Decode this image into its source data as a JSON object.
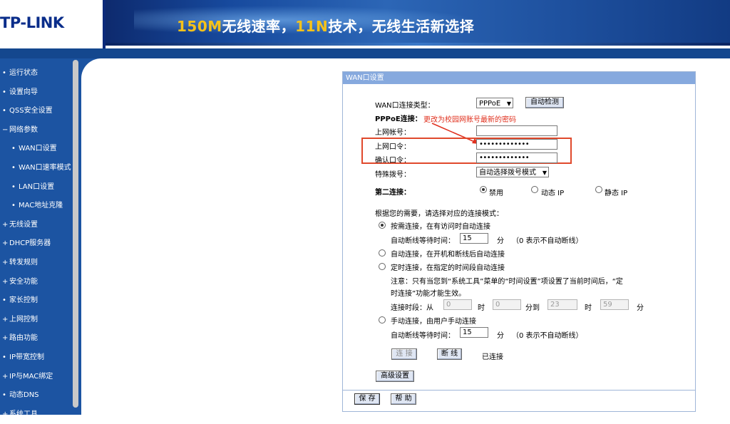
{
  "header": {
    "logo_text": "TP-LINK",
    "slogan_part1": "150M",
    "slogan_part2": "无线速率，",
    "slogan_part3": "11N",
    "slogan_part4": "技术，无线生活新选择"
  },
  "sidebar": {
    "items": [
      {
        "label": "运行状态",
        "bullet": "•",
        "sub": false
      },
      {
        "label": "设置向导",
        "bullet": "•",
        "sub": false
      },
      {
        "label": "QSS安全设置",
        "bullet": "•",
        "sub": false
      },
      {
        "label": "网络参数",
        "bullet": "−",
        "sub": false
      },
      {
        "label": "WAN口设置",
        "bullet": "•",
        "sub": true
      },
      {
        "label": "WAN口速率模式",
        "bullet": "•",
        "sub": true
      },
      {
        "label": "LAN口设置",
        "bullet": "•",
        "sub": true
      },
      {
        "label": "MAC地址克隆",
        "bullet": "•",
        "sub": true
      },
      {
        "label": "无线设置",
        "bullet": "+",
        "sub": false
      },
      {
        "label": "DHCP服务器",
        "bullet": "+",
        "sub": false
      },
      {
        "label": "转发规则",
        "bullet": "+",
        "sub": false
      },
      {
        "label": "安全功能",
        "bullet": "+",
        "sub": false
      },
      {
        "label": "家长控制",
        "bullet": "•",
        "sub": false
      },
      {
        "label": "上网控制",
        "bullet": "+",
        "sub": false
      },
      {
        "label": "路由功能",
        "bullet": "+",
        "sub": false
      },
      {
        "label": "IP带宽控制",
        "bullet": "•",
        "sub": false
      },
      {
        "label": "IP与MAC绑定",
        "bullet": "+",
        "sub": false
      },
      {
        "label": "动态DNS",
        "bullet": "•",
        "sub": false
      },
      {
        "label": "系统工具",
        "bullet": "+",
        "sub": false
      }
    ]
  },
  "panel": {
    "title": "WAN口设置",
    "conn_type_label": "WAN口连接类型：",
    "conn_type_value": "PPPoE",
    "auto_detect_button": "自动检测",
    "pppoe_label": "PPPoE连接：",
    "annotation": "更改为校园网账号最新的密码",
    "account_label": "上网帐号：",
    "account_value": "",
    "password_label": "上网口令：",
    "password_value": "•••••••••••••",
    "confirm_label": "确认口令：",
    "confirm_value": "•••••••••••••",
    "special_dial_label": "特殊拨号：",
    "special_dial_value": "自动选择拨号模式",
    "second_conn_label": "第二连接：",
    "second_disable": "禁用",
    "second_dynamic_ip": "动态 IP",
    "second_static_ip": "静态 IP",
    "mode_prompt": "根据您的需要，请选择对应的连接模式：",
    "mode_on_demand": "按需连接，在有访问时自动连接",
    "idle_label1": "自动断线等待时间：",
    "idle_value1": "15",
    "idle_unit1": "分",
    "idle_note1": "（0 表示不自动断线）",
    "mode_auto": "自动连接，在开机和断线后自动连接",
    "mode_timed": "定时连接，在指定的时间段自动连接",
    "timed_note_line1": "注意：只有当您到“系统工具”菜单的“时间设置”项设置了当前时间后，“定",
    "timed_note_line2": "时连接”功能才能生效。",
    "period_label": "连接时段：从",
    "period_h1": "0",
    "period_unit_h": "时",
    "period_m1": "0",
    "period_to": "分到",
    "period_h2": "23",
    "period_unit_h2": "时",
    "period_m2": "59",
    "period_unit_m": "分",
    "mode_manual": "手动连接，由用户手动连接",
    "idle_label2": "自动断线等待时间：",
    "idle_value2": "15",
    "idle_unit2": "分",
    "idle_note2": "（0 表示不自动断线）",
    "connect_button": "连 接",
    "disconnect_button": "断 线",
    "status_text": "已连接",
    "advanced_button": "高级设置",
    "save_button": "保 存",
    "help_button": "帮 助"
  }
}
